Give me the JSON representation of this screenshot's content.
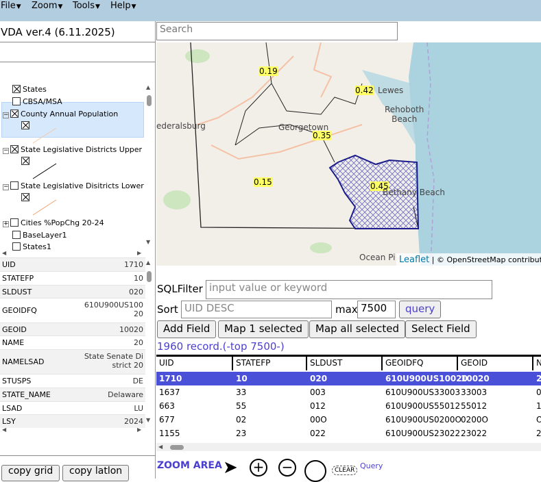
{
  "menu": {
    "file": "File",
    "zoom": "Zoom",
    "tools": "Tools",
    "help": "Help"
  },
  "app_title": "VDA ver.4 (6.11.2025)",
  "search": {
    "placeholder": "Search"
  },
  "layers": [
    {
      "label": "States",
      "checked": true
    },
    {
      "label": "CBSA/MSA",
      "checked": false
    },
    {
      "label": "County Annual Population",
      "checked": true
    },
    {
      "label": "State Legislative Districts Upper",
      "checked": true
    },
    {
      "label": "State Legislative Disitricts Lower",
      "checked": false
    },
    {
      "label": "Cities %PopChg 20-24",
      "checked": false
    },
    {
      "label": "BaseLayer1",
      "checked": false
    },
    {
      "label": "States1",
      "checked": false
    }
  ],
  "attributes": [
    {
      "key": "UID",
      "value": "1710"
    },
    {
      "key": "STATEFP",
      "value": "10"
    },
    {
      "key": "SLDUST",
      "value": "020"
    },
    {
      "key": "GEOIDFQ",
      "value": "610U900US100\n20"
    },
    {
      "key": "GEOID",
      "value": "10020"
    },
    {
      "key": "NAME",
      "value": "20"
    },
    {
      "key": "NAMELSAD",
      "value": "State Senate Di\nstrict 20"
    },
    {
      "key": "STUSPS",
      "value": "DE"
    },
    {
      "key": "STATE_NAME",
      "value": "Delaware"
    },
    {
      "key": "LSAD",
      "value": "LU"
    },
    {
      "key": "LSY",
      "value": "2024"
    }
  ],
  "map": {
    "labels": {
      "v1": "0.19",
      "v2": "0.42",
      "v3": "0.35",
      "v4": "0.15",
      "v5": "0.45",
      "lewes": "Lewes",
      "rehoboth": "Rehoboth\nBeach",
      "georgetown": "Georgetown",
      "bethany": "Bethany Beach",
      "seaford": "ederalsburg",
      "ocean": "Ocean Pi"
    },
    "attribution_link": "Leaflet",
    "attribution_text": "| © OpenStreetMap contribut"
  },
  "sql": {
    "label": "SQLFilter",
    "placeholder": "input value or keyword"
  },
  "sort": {
    "label": "Sort",
    "placeholder": "UID DESC",
    "max_label": "max",
    "max_value": "7500",
    "query_label": "query"
  },
  "buttons": {
    "add_field": "Add Field",
    "map1": "Map 1 selected",
    "map_all": "Map all selected",
    "select_field": "Select Field",
    "copy_grid": "copy grid",
    "copy_latlon": "copy latlon"
  },
  "record_count": "1960 record.(-top 7500-)",
  "grid": {
    "columns": [
      "UID",
      "STATEFP",
      "SLDUST",
      "GEOIDFQ",
      "GEOID",
      "N"
    ],
    "rows": [
      [
        "1710",
        "10",
        "020",
        "610U900US10020",
        "10020",
        "2"
      ],
      [
        "1637",
        "33",
        "003",
        "610U900US33003",
        "33003",
        "0"
      ],
      [
        "663",
        "55",
        "012",
        "610U900US55012",
        "55012",
        "1"
      ],
      [
        "677",
        "02",
        "00O",
        "610U900US0200O",
        "0200O",
        "O"
      ],
      [
        "1155",
        "23",
        "022",
        "610U900US23022",
        "23022",
        "2"
      ]
    ]
  },
  "toolbar": {
    "zoom_area": "ZOOM AREA",
    "clear": "CLEAR",
    "query": "Query"
  },
  "colors": {
    "menubar": "#b3cde0",
    "selected_row": "#4a50d8",
    "link": "#4a3fcf",
    "highlight": "#ffff66"
  }
}
